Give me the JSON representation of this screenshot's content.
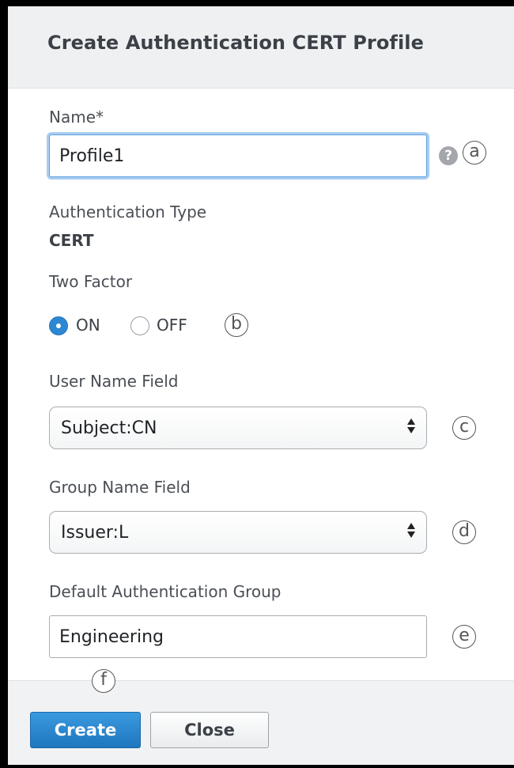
{
  "dialog": {
    "title": "Create Authentication CERT Profile"
  },
  "fields": {
    "name": {
      "label": "Name*",
      "value": "Profile1",
      "help_icon_text": "?"
    },
    "auth_type": {
      "label": "Authentication Type",
      "value": "CERT"
    },
    "two_factor": {
      "label": "Two Factor",
      "options": [
        {
          "label": "ON",
          "selected": true
        },
        {
          "label": "OFF",
          "selected": false
        }
      ]
    },
    "user_name_field": {
      "label": "User Name Field",
      "selected": "Subject:CN"
    },
    "group_name_field": {
      "label": "Group Name Field",
      "selected": "Issuer:L"
    },
    "default_auth_group": {
      "label": "Default Authentication Group",
      "value": "Engineering"
    }
  },
  "callouts": {
    "a": "a",
    "b": "b",
    "c": "c",
    "d": "d",
    "e": "e",
    "f": "f"
  },
  "buttons": {
    "create": "Create",
    "close": "Close"
  },
  "colors": {
    "primary_button": "#2d87d2",
    "focus_ring": "#a9cdf1",
    "header_bg": "#eef0f1"
  }
}
